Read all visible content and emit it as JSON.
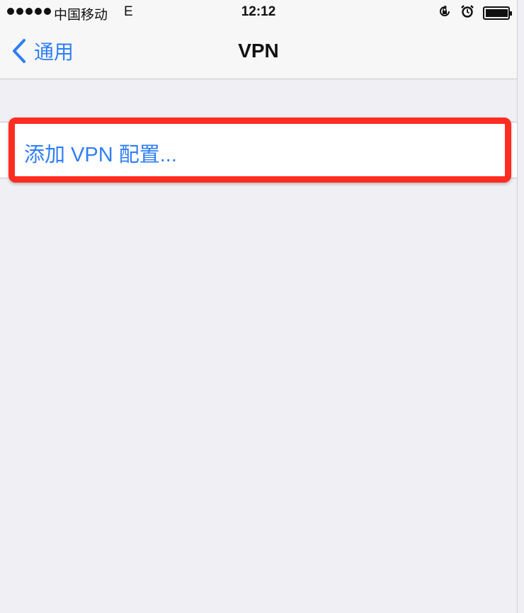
{
  "status_bar": {
    "carrier": "中国移动",
    "network": "E",
    "time": "12:12",
    "icons": [
      "orientation-lock-icon",
      "alarm-icon",
      "battery-icon"
    ],
    "battery_level": 0.9
  },
  "nav": {
    "back_label": "通用",
    "title": "VPN"
  },
  "list": {
    "add_vpn_label": "添加 VPN 配置..."
  },
  "colors": {
    "accent": "#2f7ef7",
    "highlight": "#ff2d20",
    "background": "#efeff4"
  }
}
